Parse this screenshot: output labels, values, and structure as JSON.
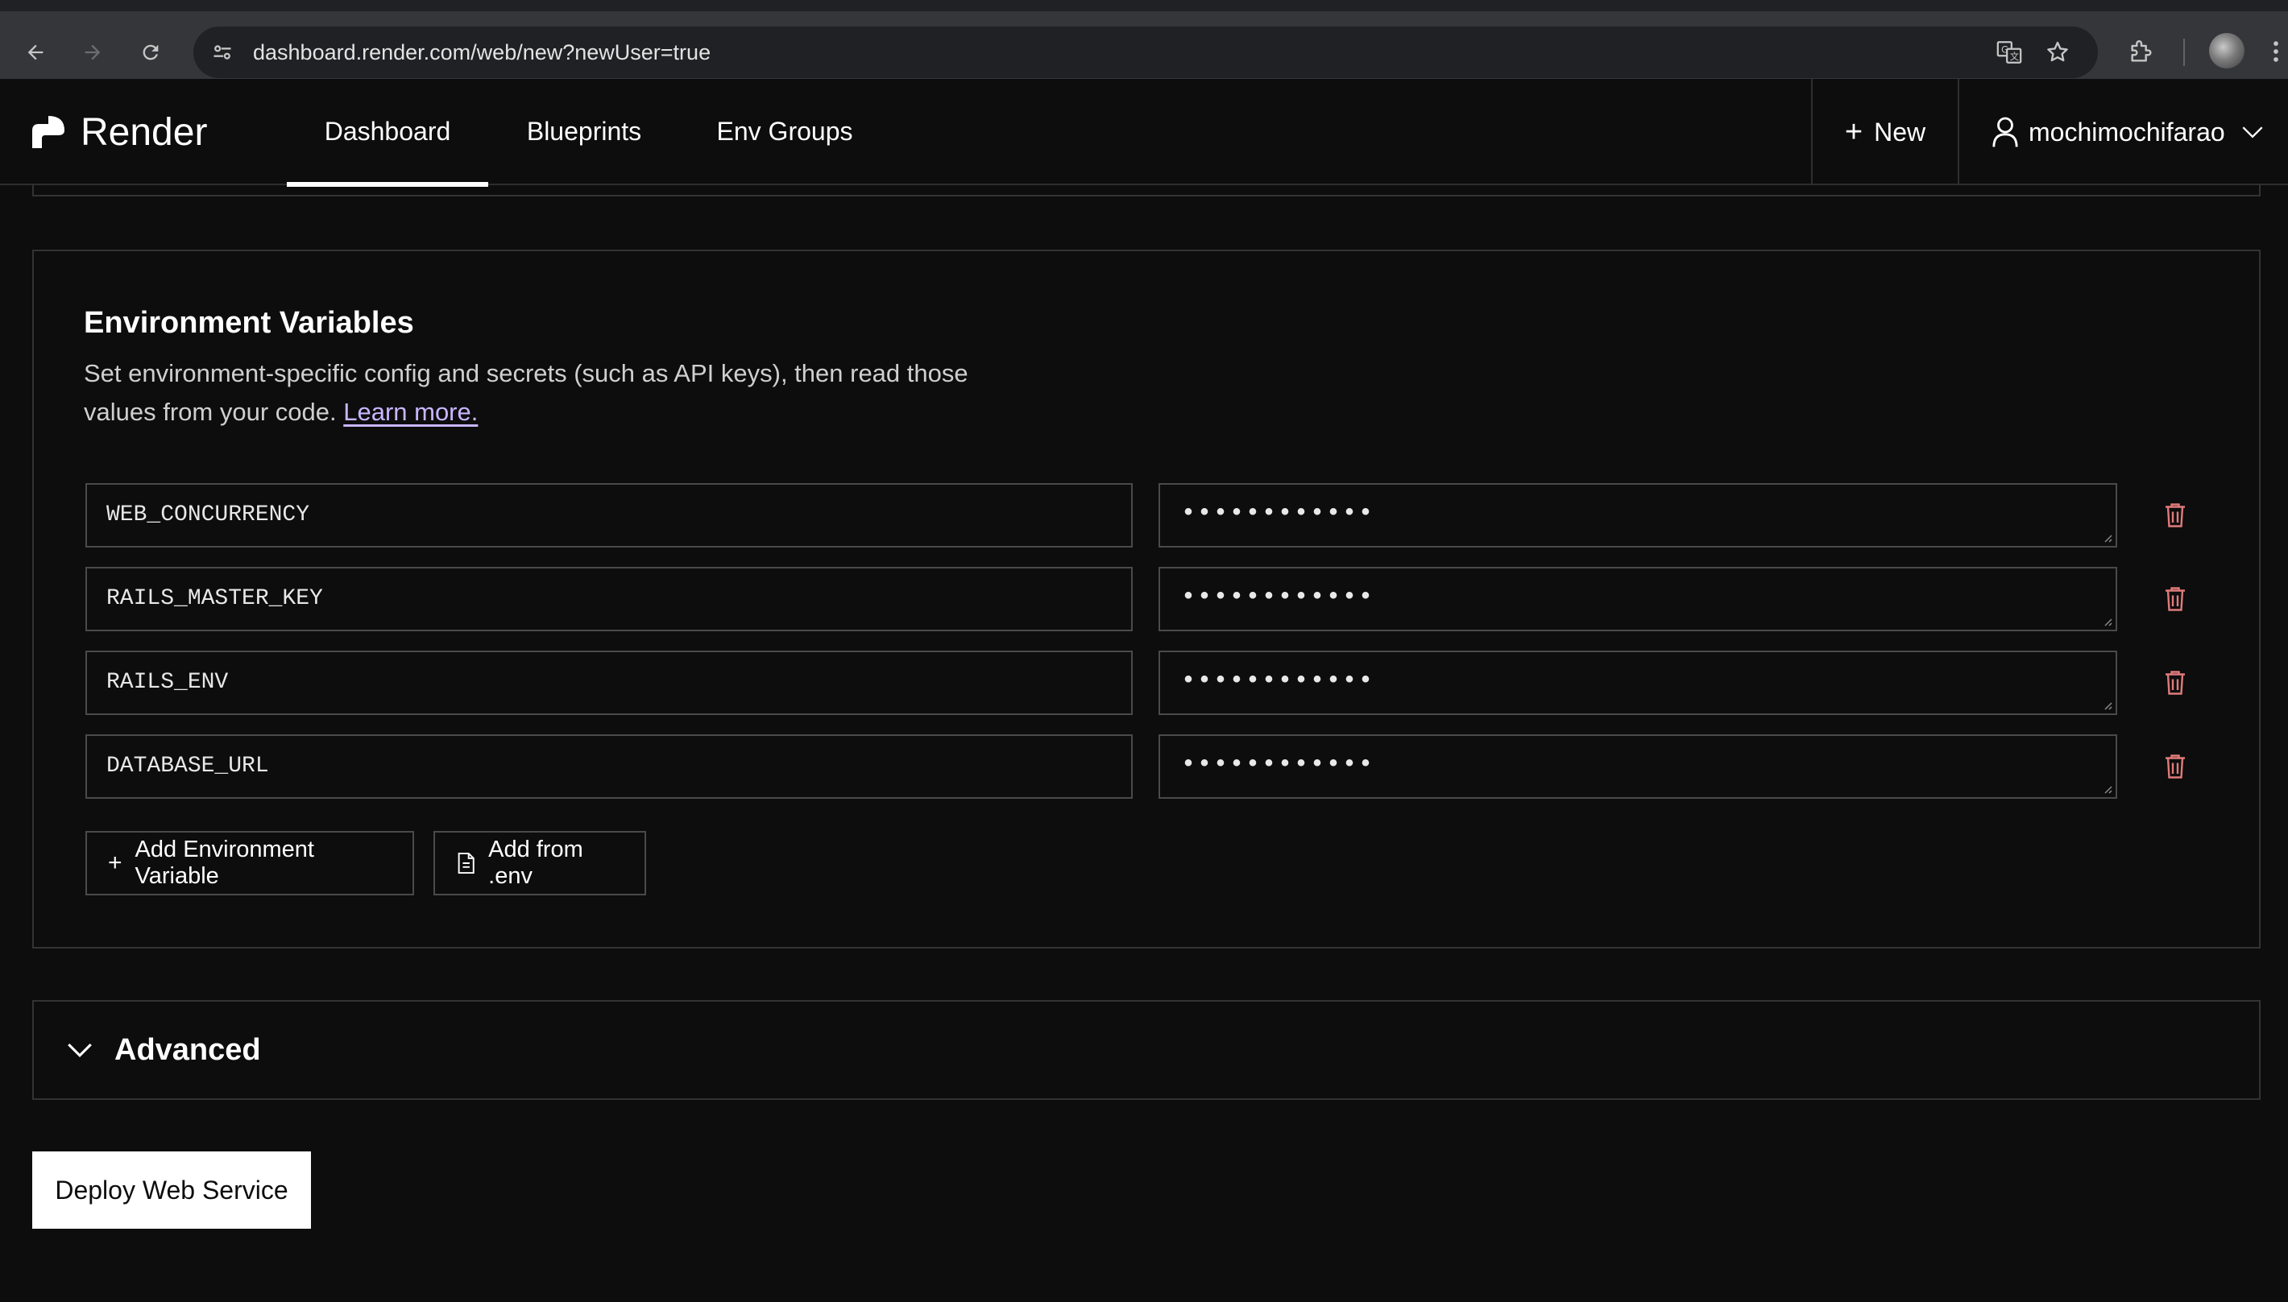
{
  "browser": {
    "url": "dashboard.render.com/web/new?newUser=true"
  },
  "header": {
    "brand": "Render",
    "tabs": [
      {
        "label": "Dashboard",
        "active": true
      },
      {
        "label": "Blueprints",
        "active": false
      },
      {
        "label": "Env Groups",
        "active": false
      }
    ],
    "new_label": "New",
    "username": "mochimochifarao"
  },
  "env": {
    "title": "Environment Variables",
    "description": "Set environment-specific config and secrets (such as API keys), then read those values from your code.",
    "learn_more": "Learn more.",
    "variables": [
      {
        "key": "WEB_CONCURRENCY",
        "value": "••••••••••••"
      },
      {
        "key": "RAILS_MASTER_KEY",
        "value": "••••••••••••"
      },
      {
        "key": "RAILS_ENV",
        "value": "••••••••••••"
      },
      {
        "key": "DATABASE_URL",
        "value": "••••••••••••"
      }
    ],
    "add_variable_label": "Add Environment Variable",
    "add_from_env_label": "Add from .env"
  },
  "advanced": {
    "label": "Advanced"
  },
  "deploy": {
    "label": "Deploy Web Service"
  },
  "colors": {
    "background": "#0d0d0d",
    "border": "#333333",
    "link": "#c8b6ff",
    "trash": "#e07b7b"
  }
}
